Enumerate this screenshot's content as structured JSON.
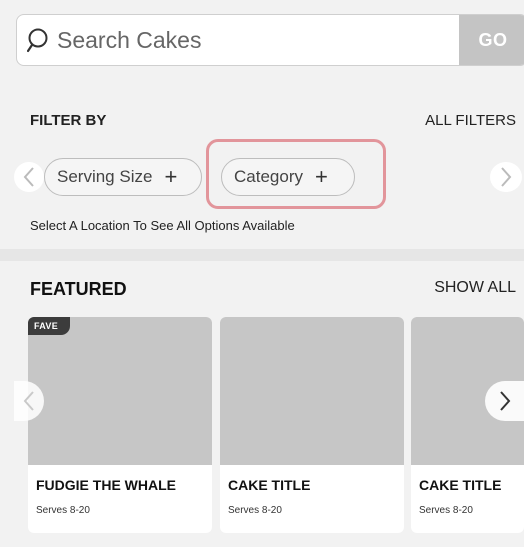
{
  "search": {
    "placeholder": "Search Cakes",
    "go_label": "GO",
    "icon": "search-icon"
  },
  "filters": {
    "heading": "FILTER BY",
    "all_filters_label": "ALL FILTERS",
    "chips": [
      {
        "label": "Serving Size",
        "icon": "plus-icon"
      },
      {
        "label": "Category",
        "icon": "plus-icon",
        "highlighted": true
      }
    ],
    "location_note": "Select A Location To See All Options Available"
  },
  "featured": {
    "heading": "FEATURED",
    "show_all_label": "SHOW ALL",
    "cards": [
      {
        "badge": "FAVE",
        "title": "FUDGIE THE WHALE",
        "subtitle": "Serves 8-20"
      },
      {
        "title": "CAKE TITLE",
        "subtitle": "Serves 8-20"
      },
      {
        "title": "CAKE TITLE",
        "subtitle": "Serves 8-20"
      }
    ]
  },
  "colors": {
    "highlight": "#e2959b",
    "go_button": "#c4c4c4",
    "image_placeholder": "#c6c6c6",
    "badge": "#3c3c3c"
  }
}
